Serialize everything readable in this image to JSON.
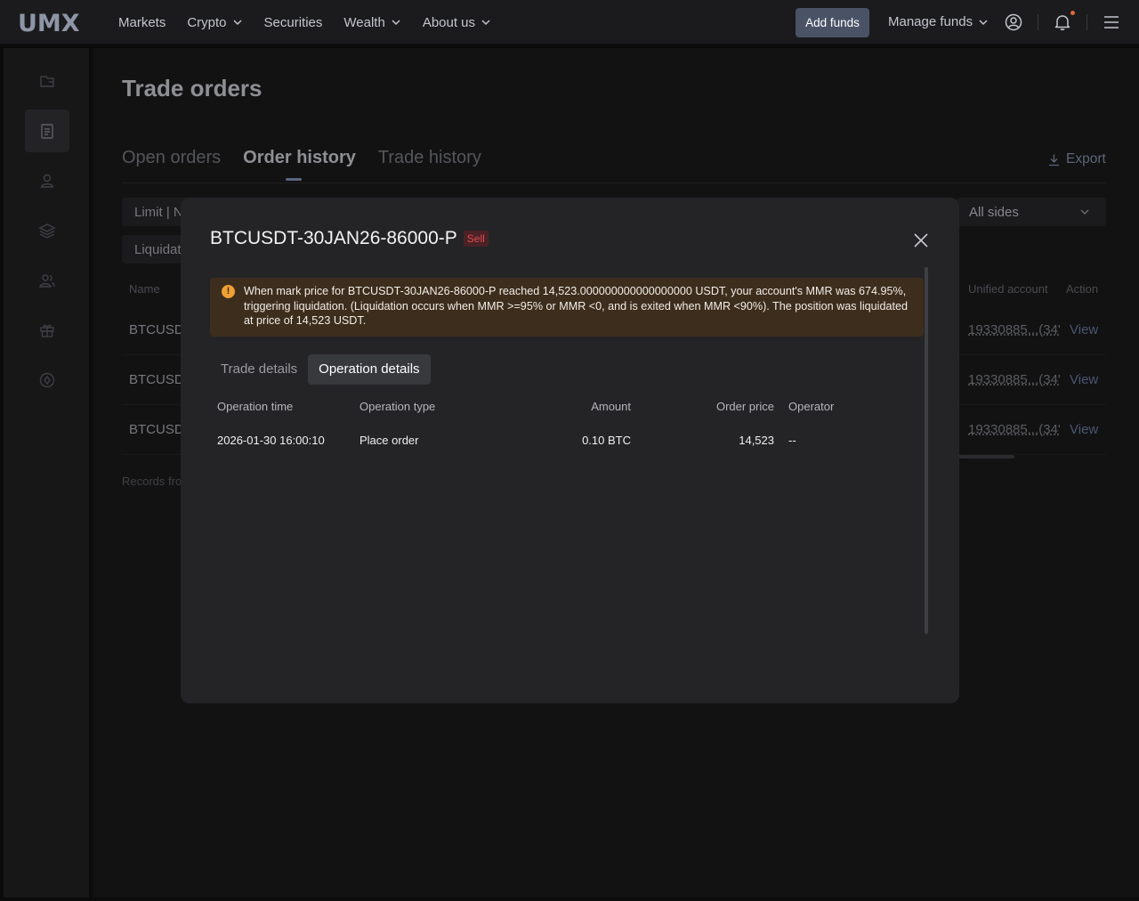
{
  "brand": {
    "logo": "UMX"
  },
  "nav": {
    "items": [
      {
        "label": "Markets",
        "dropdown": false
      },
      {
        "label": "Crypto",
        "dropdown": true
      },
      {
        "label": "Securities",
        "dropdown": false
      },
      {
        "label": "Wealth",
        "dropdown": true
      },
      {
        "label": "About us",
        "dropdown": true
      }
    ],
    "add_funds": "Add funds",
    "manage_funds": "Manage funds",
    "icons": [
      "user-circle-icon",
      "bell-icon",
      "menu-icon"
    ]
  },
  "sidebar": {
    "items": [
      "wallet-icon",
      "orders-icon",
      "profile-icon",
      "layers-icon",
      "users-icon",
      "gift-icon",
      "compass-icon"
    ],
    "active_index": 1
  },
  "page": {
    "title": "Trade orders",
    "tabs": [
      "Open orders",
      "Order history",
      "Trade history"
    ],
    "active_tab": "Order history",
    "export_label": "Export",
    "filters": {
      "type_partial": "Limit | N",
      "liquidation_partial": "Liquidat",
      "sides": "All sides"
    },
    "columns": {
      "name": "Name",
      "account": "Unified account",
      "action": "Action"
    },
    "rows": [
      {
        "name": "BTCUSDT",
        "account": "19330885...(34'",
        "action": "View"
      },
      {
        "name": "BTCUSDT",
        "account": "19330885...(34'",
        "action": "View"
      },
      {
        "name": "BTCUSDT",
        "account": "19330885...(34'",
        "action": "View"
      }
    ],
    "records_partial": "Records fro"
  },
  "modal": {
    "title": "BTCUSDT-30JAN26-86000-P",
    "side": "Sell",
    "notice": "When mark price for BTCUSDT-30JAN26-86000-P reached 14,523.000000000000000000 USDT, your account's MMR was 674.95%, triggering liquidation. (Liquidation occurs when MMR >=95% or MMR <0, and is exited when MMR <90%). The position was liquidated at price of 14,523 USDT.",
    "tabs": [
      "Trade details",
      "Operation details"
    ],
    "active_tab": "Operation details",
    "table": {
      "headers": [
        "Operation time",
        "Operation type",
        "Amount",
        "Order price",
        "Operator"
      ],
      "rows": [
        [
          "2026-01-30 16:00:10",
          "Place order",
          "0.10 BTC",
          "14,523",
          "--"
        ]
      ]
    }
  },
  "colors": {
    "accent": "#4a5266",
    "sell": "#e0494f",
    "warning_bg": "#3d2d1d",
    "warning_icon": "#f0a033"
  }
}
